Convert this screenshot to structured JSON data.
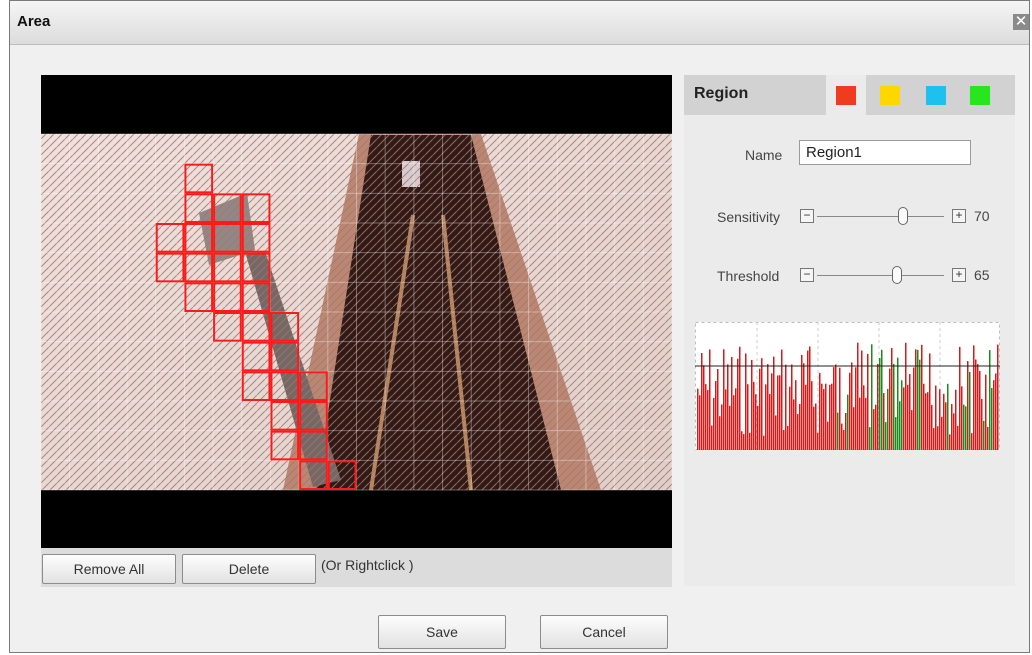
{
  "dialog": {
    "title": "Area",
    "close_icon": "close-icon"
  },
  "video": {
    "grid_cols": 22,
    "grid_rows": 12,
    "selected_cells": [
      [
        5,
        1
      ],
      [
        5,
        2
      ],
      [
        6,
        2
      ],
      [
        7,
        2
      ],
      [
        4,
        3
      ],
      [
        5,
        3
      ],
      [
        6,
        3
      ],
      [
        7,
        3
      ],
      [
        4,
        4
      ],
      [
        5,
        4
      ],
      [
        6,
        4
      ],
      [
        7,
        4
      ],
      [
        5,
        5
      ],
      [
        6,
        5
      ],
      [
        7,
        5
      ],
      [
        6,
        6
      ],
      [
        7,
        6
      ],
      [
        8,
        6
      ],
      [
        7,
        7
      ],
      [
        8,
        7
      ],
      [
        7,
        8
      ],
      [
        8,
        8
      ],
      [
        9,
        8
      ],
      [
        8,
        9
      ],
      [
        9,
        9
      ],
      [
        8,
        10
      ],
      [
        9,
        10
      ],
      [
        9,
        11
      ],
      [
        10,
        11
      ]
    ],
    "selection_color": "#ff1a1a"
  },
  "controls": {
    "remove_all_label": "Remove All",
    "delete_label": "Delete",
    "hint_text": "(Or Rightclick )"
  },
  "region_panel": {
    "title": "Region",
    "colors": [
      {
        "name": "red",
        "hex": "#f03c1e",
        "active": true
      },
      {
        "name": "yellow",
        "hex": "#ffd700",
        "active": false
      },
      {
        "name": "blue",
        "hex": "#1ec0f0",
        "active": false
      },
      {
        "name": "green",
        "hex": "#27e61e",
        "active": false
      }
    ],
    "name_label": "Name",
    "name_value": "Region1",
    "sensitivity_label": "Sensitivity",
    "sensitivity_value": "70",
    "threshold_label": "Threshold",
    "threshold_value": "65",
    "graph_colors": {
      "above": "#d61a1a",
      "below": "#1a8a1a"
    }
  },
  "footer": {
    "save_label": "Save",
    "cancel_label": "Cancel"
  }
}
